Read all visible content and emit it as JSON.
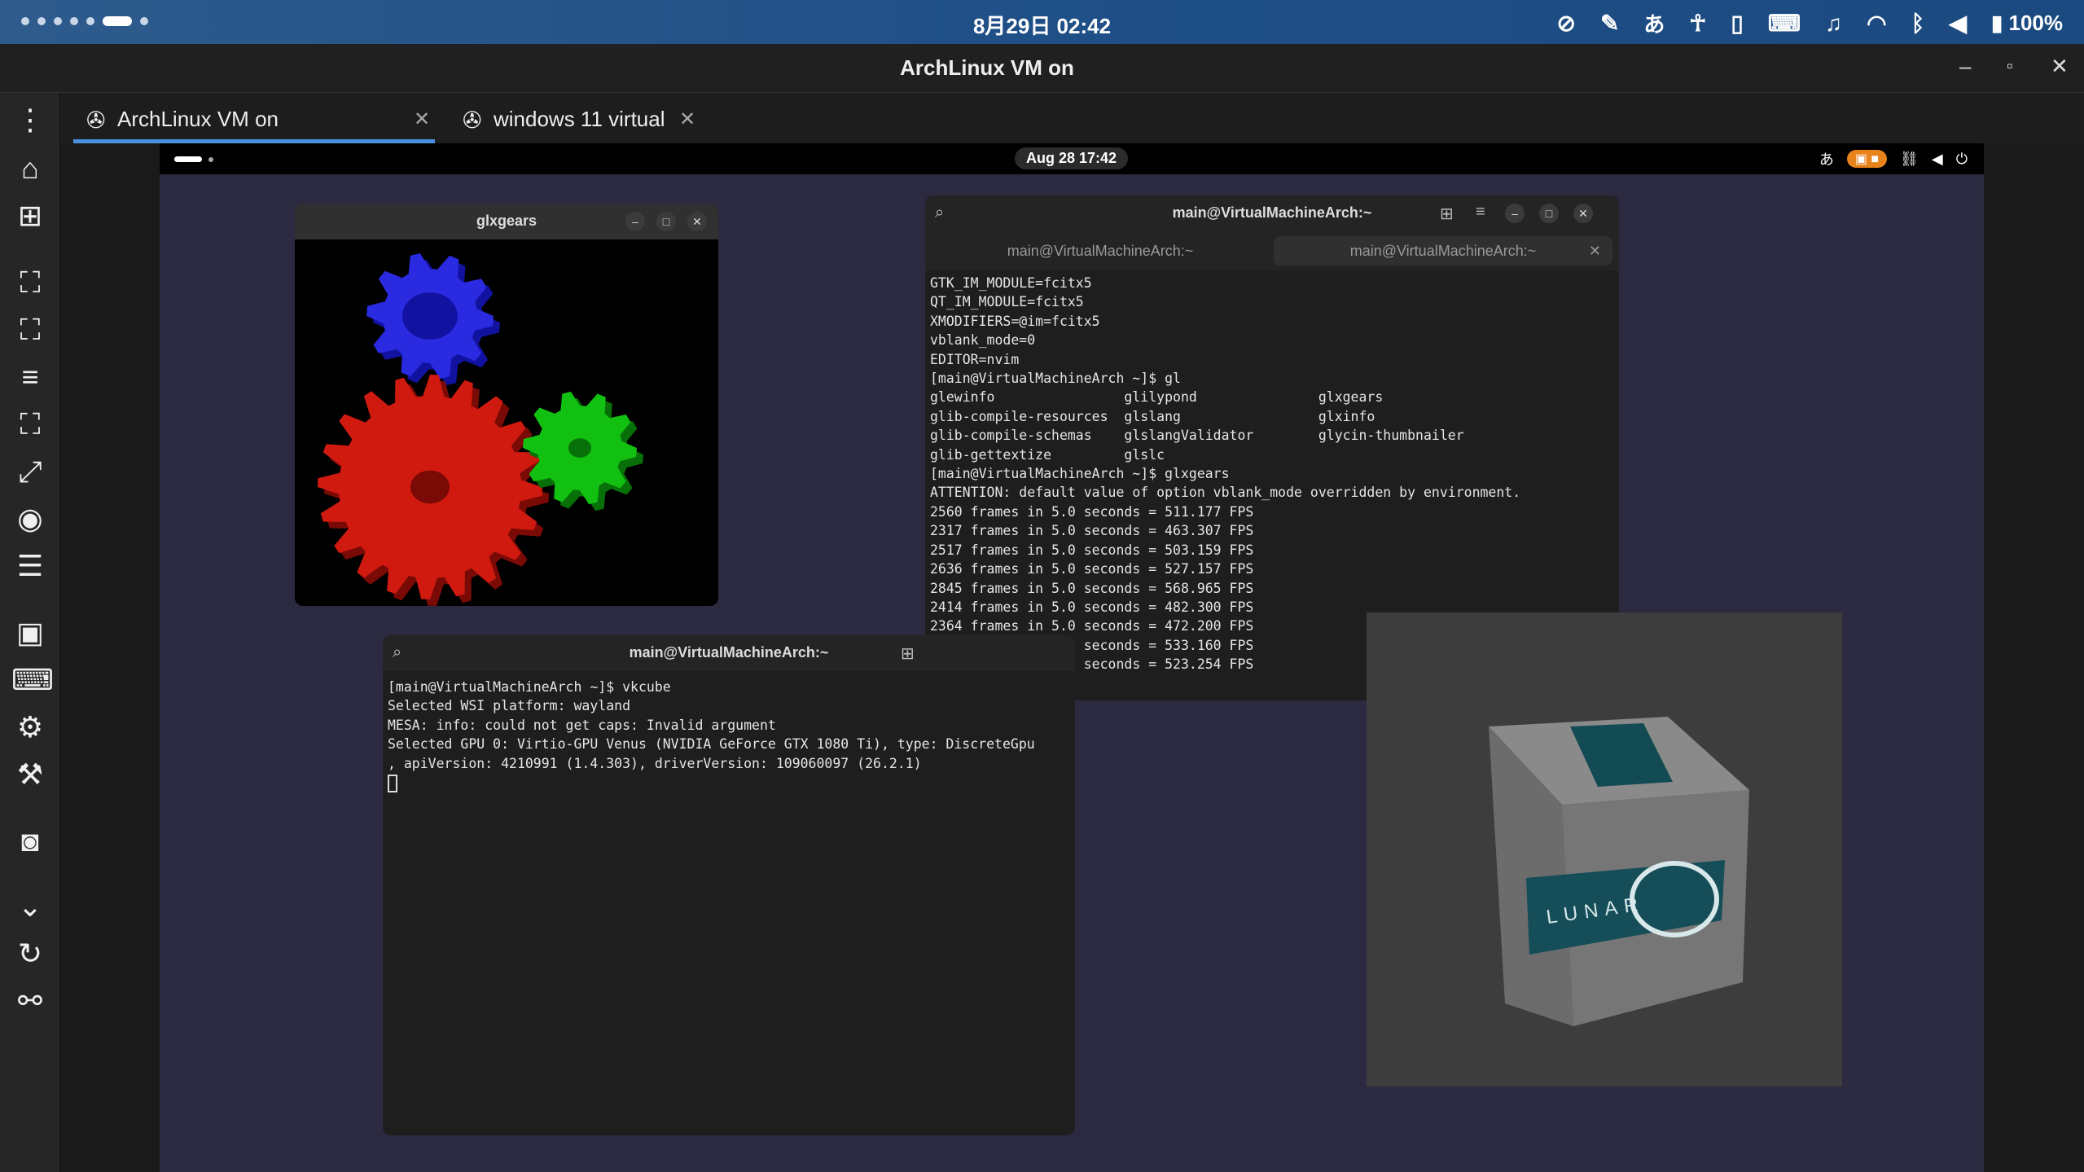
{
  "statusbar": {
    "clock": "8月29日 02:42",
    "ime": "あ",
    "battery": "100%"
  },
  "app": {
    "title": "ArchLinux VM on",
    "window_controls": [
      "–",
      "▫",
      "✕"
    ]
  },
  "tabs": [
    {
      "label": "ArchLinux VM on",
      "active": true
    },
    {
      "label": "windows 11 virtual",
      "active": false
    }
  ],
  "vm": {
    "topbar": {
      "date": "Aug 28 17:42",
      "ime": "あ"
    },
    "glxgears": {
      "title": "glxgears"
    },
    "terminal_main": {
      "title": "main@VirtualMachineArch:~",
      "tabs": [
        "main@VirtualMachineArch:~",
        "main@VirtualMachineArch:~"
      ],
      "lines": [
        "GTK_IM_MODULE=fcitx5",
        "QT_IM_MODULE=fcitx5",
        "XMODIFIERS=@im=fcitx5",
        "vblank_mode=0",
        "EDITOR=nvim",
        "[main@VirtualMachineArch ~]$ gl",
        "glewinfo                glilypond               glxgears",
        "glib-compile-resources  glslang                 glxinfo",
        "glib-compile-schemas    glslangValidator        glycin-thumbnailer",
        "glib-gettextize         glslc",
        "[main@VirtualMachineArch ~]$ glxgears",
        "ATTENTION: default value of option vblank_mode overridden by environment.",
        "2560 frames in 5.0 seconds = 511.177 FPS",
        "2317 frames in 5.0 seconds = 463.307 FPS",
        "2517 frames in 5.0 seconds = 503.159 FPS",
        "2636 frames in 5.0 seconds = 527.157 FPS",
        "2845 frames in 5.0 seconds = 568.965 FPS",
        "2414 frames in 5.0 seconds = 482.300 FPS",
        "2364 frames in 5.0 seconds = 472.200 FPS",
        "2667 frames in 5.0 seconds = 533.160 FPS",
        "2617 frames in 5.0 seconds = 523.254 FPS"
      ]
    },
    "terminal_vkcube": {
      "title": "main@VirtualMachineArch:~",
      "lines": [
        "[main@VirtualMachineArch ~]$ vkcube",
        "Selected WSI platform: wayland",
        "MESA: info: could not get caps: Invalid argument",
        "Selected GPU 0: Virtio-GPU Venus (NVIDIA GeForce GTX 1080 Ti), type: DiscreteGpu",
        ", apiVersion: 4210991 (1.4.303), driverVersion: 109060097 (26.2.1)"
      ]
    },
    "vkcube": {
      "logo_text": "LUNAR"
    }
  }
}
